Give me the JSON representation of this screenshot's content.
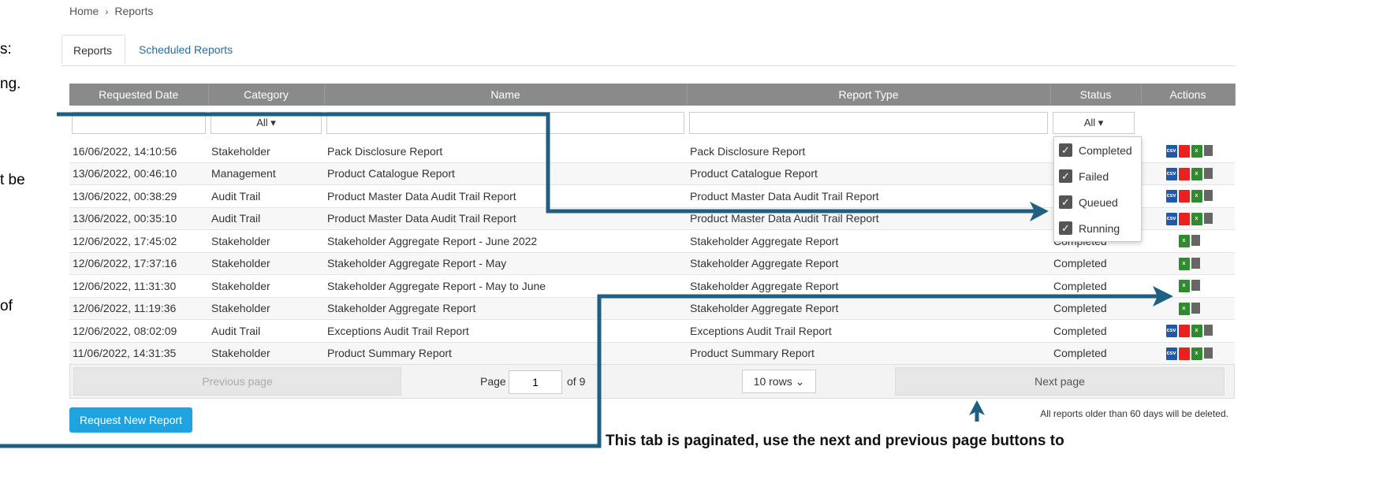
{
  "side_text": [
    "s:",
    "ng.",
    "t be",
    "of"
  ],
  "breadcrumb": {
    "home": "Home",
    "separator": "›",
    "current": "Reports"
  },
  "tabs": [
    {
      "label": "Reports"
    },
    {
      "label": "Scheduled Reports"
    }
  ],
  "table": {
    "columns": [
      "Requested Date",
      "Category",
      "Name",
      "Report Type",
      "Status",
      "Actions"
    ],
    "filters": {
      "category": "All ▾",
      "status": "All ▾"
    },
    "rows": [
      {
        "date": "16/06/2022, 14:10:56",
        "category": "Stakeholder",
        "name": "Pack Disclosure Report",
        "type": "Pack Disclosure Report",
        "status": "",
        "actions": [
          "csv",
          "pdf",
          "xls",
          "delete"
        ]
      },
      {
        "date": "13/06/2022, 00:46:10",
        "category": "Management",
        "name": "Product Catalogue Report",
        "type": "Product Catalogue Report",
        "status": "",
        "actions": [
          "csv",
          "pdf",
          "xls",
          "delete"
        ]
      },
      {
        "date": "13/06/2022, 00:38:29",
        "category": "Audit Trail",
        "name": "Product Master Data Audit Trail Report",
        "type": "Product Master Data Audit Trail Report",
        "status": "",
        "actions": [
          "csv",
          "pdf",
          "xls",
          "delete"
        ]
      },
      {
        "date": "13/06/2022, 00:35:10",
        "category": "Audit Trail",
        "name": "Product Master Data Audit Trail Report",
        "type": "Product Master Data Audit Trail Report",
        "status": "",
        "actions": [
          "csv",
          "pdf",
          "xls",
          "delete"
        ]
      },
      {
        "date": "12/06/2022, 17:45:02",
        "category": "Stakeholder",
        "name": "Stakeholder Aggregate Report - June 2022",
        "type": "Stakeholder Aggregate Report",
        "status": "Completed",
        "actions": [
          "xls",
          "delete"
        ]
      },
      {
        "date": "12/06/2022, 17:37:16",
        "category": "Stakeholder",
        "name": "Stakeholder Aggregate Report - May",
        "type": "Stakeholder Aggregate Report",
        "status": "Completed",
        "actions": [
          "xls",
          "delete"
        ]
      },
      {
        "date": "12/06/2022, 11:31:30",
        "category": "Stakeholder",
        "name": "Stakeholder Aggregate Report - May to June",
        "type": "Stakeholder Aggregate Report",
        "status": "Completed",
        "actions": [
          "xls",
          "delete"
        ]
      },
      {
        "date": "12/06/2022, 11:19:36",
        "category": "Stakeholder",
        "name": "Stakeholder Aggregate Report",
        "type": "Stakeholder Aggregate Report",
        "status": "Completed",
        "actions": [
          "xls",
          "delete"
        ]
      },
      {
        "date": "12/06/2022, 08:02:09",
        "category": "Audit Trail",
        "name": "Exceptions Audit Trail Report",
        "type": "Exceptions Audit Trail Report",
        "status": "Completed",
        "actions": [
          "csv",
          "pdf",
          "xls",
          "delete"
        ]
      },
      {
        "date": "11/06/2022, 14:31:35",
        "category": "Stakeholder",
        "name": "Product Summary Report",
        "type": "Product Summary Report",
        "status": "Completed",
        "actions": [
          "csv",
          "pdf",
          "xls",
          "delete"
        ]
      }
    ]
  },
  "status_dropdown": {
    "options": [
      {
        "label": "Completed",
        "checked": true
      },
      {
        "label": "Failed",
        "checked": true
      },
      {
        "label": "Queued",
        "checked": true
      },
      {
        "label": "Running",
        "checked": true
      }
    ]
  },
  "pagination": {
    "previous_label": "Previous page",
    "page_label": "Page",
    "page_value": "1",
    "of_label": "of 9",
    "rows_selected": "10 rows",
    "next_label": "Next page"
  },
  "request_button": "Request New Report",
  "retention_note": "All reports older than 60 days will be deleted.",
  "caption": "This tab is paginated, use the next and previous page buttons to",
  "colors": {
    "annotation_arrow": "#1f5f82",
    "header_bg": "#8a8a8a",
    "request_button": "#1fa3e0",
    "link": "#1a6faa"
  }
}
